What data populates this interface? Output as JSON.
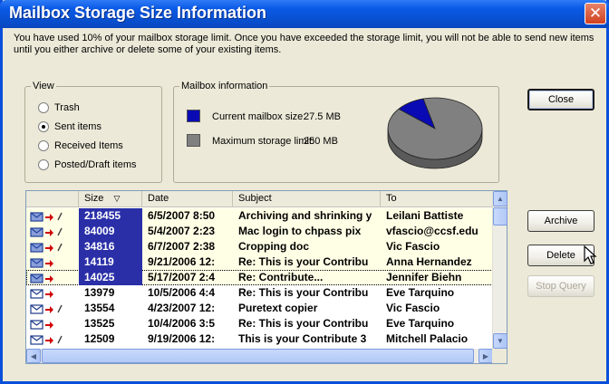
{
  "window": {
    "title": "Mailbox Storage Size Information",
    "close_glyph": "✕"
  },
  "info_text": "You have used 10% of your mailbox storage limit.  Once you have exceeded the storage limit, you will not be able to send new items until you either archive or delete some of your existing items.",
  "view": {
    "title": "View",
    "options": [
      {
        "label": "Trash",
        "selected": false
      },
      {
        "label": "Sent items",
        "selected": true
      },
      {
        "label": "Received Items",
        "selected": false
      },
      {
        "label": "Posted/Draft items",
        "selected": false
      }
    ]
  },
  "mailbox_info": {
    "title": "Mailbox information",
    "current_label": "Current mailbox size:",
    "current_value": "27.5 MB",
    "current_color": "#0a0ab4",
    "max_label": "Maximum storage limit:",
    "max_value": "250 MB",
    "max_color": "#808080",
    "usage_fraction": 0.1
  },
  "buttons": {
    "close": "Close",
    "archive": "Archive",
    "delete": "Delete",
    "stop_query": "Stop Query"
  },
  "table": {
    "columns": [
      "",
      "Size",
      "Date",
      "Subject",
      "To"
    ],
    "sort_indicator": "▽",
    "rows": [
      {
        "size": "218455",
        "date": "6/5/2007 8:50",
        "subject": "Archiving and shrinking y",
        "to": "Leilani Battiste",
        "selected": true,
        "attach": true
      },
      {
        "size": "84009",
        "date": "5/4/2007 2:23",
        "subject": "Mac login to chpass pix",
        "to": "vfascio@ccsf.edu",
        "selected": true,
        "attach": true
      },
      {
        "size": "34816",
        "date": "6/7/2007 2:38",
        "subject": "Cropping doc",
        "to": "Vic Fascio",
        "selected": true,
        "attach": true
      },
      {
        "size": "14119",
        "date": "9/21/2006 12:",
        "subject": "Re: This is your Contribu",
        "to": "Anna Hernandez",
        "selected": true,
        "attach": false
      },
      {
        "size": "14025",
        "date": "5/17/2007 2:4",
        "subject": "Re: Contribute...",
        "to": "Jennifer Biehn",
        "selected": true,
        "attach": false
      },
      {
        "size": "13979",
        "date": "10/5/2006 4:4",
        "subject": "Re: This is your Contribu",
        "to": "Eve Tarquino",
        "selected": false,
        "attach": false
      },
      {
        "size": "13554",
        "date": "4/23/2007 12:",
        "subject": "Puretext copier",
        "to": "Vic Fascio",
        "selected": false,
        "attach": true
      },
      {
        "size": "13525",
        "date": "10/4/2006 3:5",
        "subject": "Re: This is your Contribu",
        "to": "Eve Tarquino",
        "selected": false,
        "attach": false
      },
      {
        "size": "12509",
        "date": "9/19/2006 12:",
        "subject": "This is your Contribute 3",
        "to": "Mitchell Palacio",
        "selected": false,
        "attach": true
      }
    ]
  }
}
